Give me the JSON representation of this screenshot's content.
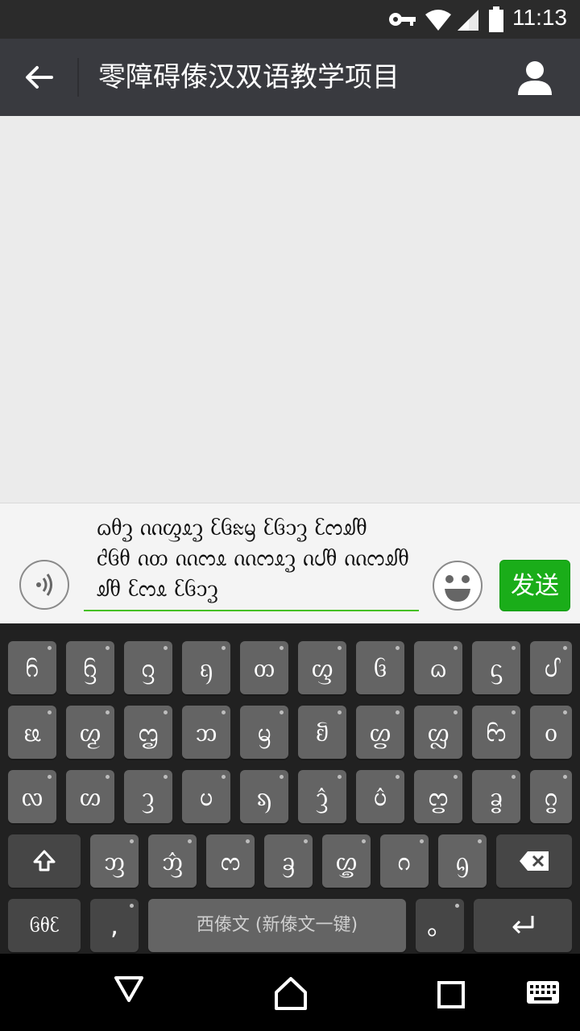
{
  "status_bar": {
    "time": "11:13"
  },
  "header": {
    "title": "零障碍傣汉双语教学项目"
  },
  "composer": {
    "message": "ᦒᦲᧆ ᦶᦐᦸᧆ ᦷᦑᦰᦙ ᦷᦑᦱᧆ ᦷᦂᦾᦲ\nᦺᦑᦲ ᦵᦎ ᦶᦂᦸ ᦶᦂᦸᧆ ᦵᦔᦲ ᦶᦂᦾᦲ\nᦾᦲ ᦷᦂᦸ ᦷᦑᦱᧆ",
    "send_label": "发送"
  },
  "keyboard": {
    "row1": [
      "ᦆ",
      "ᦌ",
      "ᦋ",
      "ᦏ",
      "ᦎ",
      "ᦐ",
      "ᦑ",
      "ᦒ",
      "ᦓ",
      "ᦔ"
    ],
    "row2": [
      "ᦕ",
      "ᦖ",
      "ᦗ",
      "ᦘ",
      "ᦙ",
      "ᦚ",
      "ᦛ",
      "ᦜ",
      "ᦝ",
      "ᦞ"
    ],
    "row3": [
      "ᦟ",
      "ᦠ",
      "ᦡ",
      "ᦢ",
      "ᦣ",
      "ᦤ",
      "ᦥ",
      "ᦦ",
      "ᦧ",
      "ᦨ"
    ],
    "row4": [
      "ᦀ",
      "ᦁ",
      "ᦂ",
      "ᦃ",
      "ᦄ",
      "ᦅ",
      "ᦇ"
    ],
    "mode_label": "ᦑᦲᦷ",
    "comma_label": ",",
    "space_label": "西傣文 (新傣文一键)",
    "period_label": "。"
  },
  "icons": {
    "status": [
      "key-icon",
      "wifi-icon",
      "signal-icon",
      "battery-icon"
    ],
    "header": [
      "back-arrow-icon",
      "profile-icon"
    ],
    "nav": [
      "back-triangle-icon",
      "home-icon",
      "recents-icon",
      "keyboard-switch-icon"
    ]
  },
  "colors": {
    "accent": "#1aad19",
    "header_bg": "#393a3f",
    "keyboard_bg": "#212121",
    "key_bg": "#646464"
  }
}
